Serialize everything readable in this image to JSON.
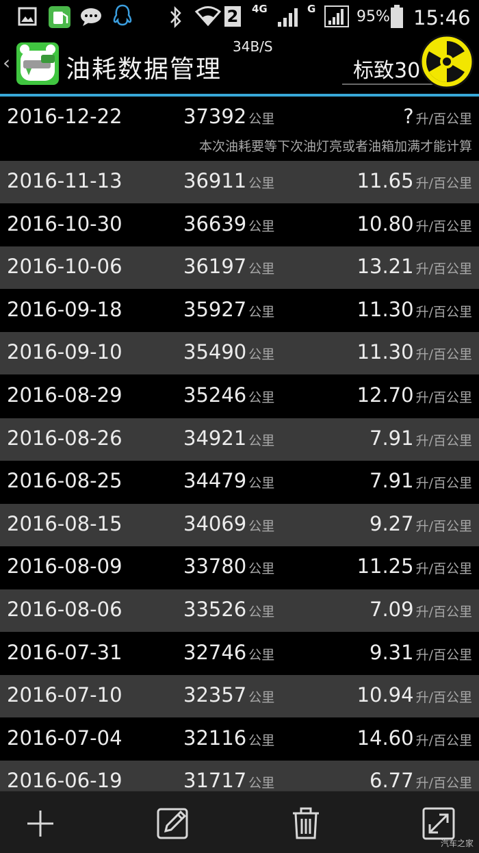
{
  "status_bar": {
    "network_type": "4G",
    "network_type_2": "G",
    "sim_slot": "2",
    "battery": "95%",
    "time": "15:46",
    "net_speed": "34B/S"
  },
  "header": {
    "app_title": "油耗数据管理",
    "car_selector": "标致30"
  },
  "units": {
    "distance": "公里",
    "consumption": "升/百公里"
  },
  "pending": {
    "date": "2016-12-22",
    "odometer": "37392",
    "consumption": "?",
    "note": "本次油耗要等下次油灯亮或者油箱加满才能计算"
  },
  "records": [
    {
      "date": "2016-11-13",
      "odometer": "36911",
      "consumption": "11.65"
    },
    {
      "date": "2016-10-30",
      "odometer": "36639",
      "consumption": "10.80"
    },
    {
      "date": "2016-10-06",
      "odometer": "36197",
      "consumption": "13.21"
    },
    {
      "date": "2016-09-18",
      "odometer": "35927",
      "consumption": "11.30"
    },
    {
      "date": "2016-09-10",
      "odometer": "35490",
      "consumption": "11.30"
    },
    {
      "date": "2016-08-29",
      "odometer": "35246",
      "consumption": "12.70"
    },
    {
      "date": "2016-08-26",
      "odometer": "34921",
      "consumption": "7.91"
    },
    {
      "date": "2016-08-25",
      "odometer": "34479",
      "consumption": "7.91"
    },
    {
      "date": "2016-08-15",
      "odometer": "34069",
      "consumption": "9.27"
    },
    {
      "date": "2016-08-09",
      "odometer": "33780",
      "consumption": "11.25"
    },
    {
      "date": "2016-08-06",
      "odometer": "33526",
      "consumption": "7.09"
    },
    {
      "date": "2016-07-31",
      "odometer": "32746",
      "consumption": "9.31"
    },
    {
      "date": "2016-07-10",
      "odometer": "32357",
      "consumption": "10.94"
    },
    {
      "date": "2016-07-04",
      "odometer": "32116",
      "consumption": "14.60"
    },
    {
      "date": "2016-06-19",
      "odometer": "31717",
      "consumption": "6.77"
    }
  ],
  "toolbar": {
    "icons": [
      "plus-icon",
      "edit-icon",
      "trash-icon",
      "expand-icon"
    ]
  },
  "watermark": "汽车之家",
  "colors": {
    "accent": "#38a8d8",
    "row_alt": "#3a3a3a",
    "app_icon": "#40c540",
    "radiation": "#f2e600"
  }
}
